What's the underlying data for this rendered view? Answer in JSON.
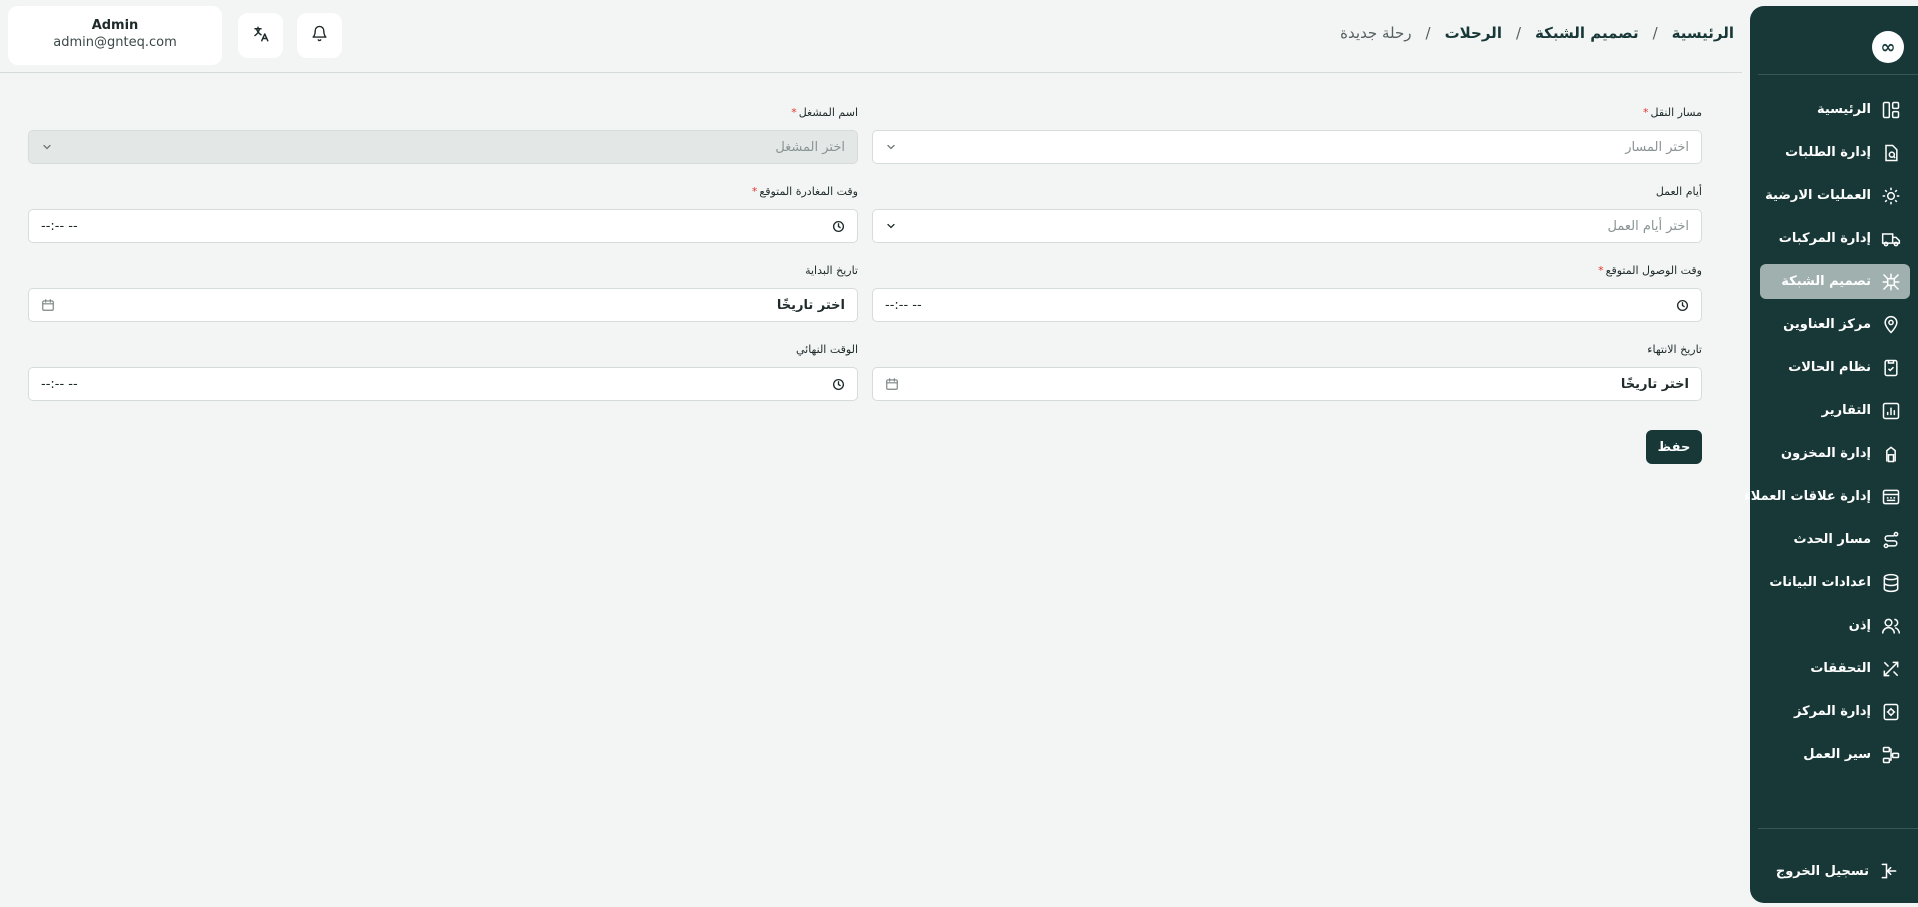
{
  "header": {
    "user": {
      "name": "Admin",
      "email": "admin@gnteq.com"
    },
    "breadcrumb": [
      "الرئيسية",
      "تصميم الشبكة",
      "الرحلات",
      "رحلة جديدة"
    ],
    "separator": "/"
  },
  "sidebar": {
    "logo": "∞",
    "items": [
      {
        "label": "الرئيسية",
        "icon": "dashboard-icon"
      },
      {
        "label": "إدارة الطلبات",
        "icon": "orders-icon"
      },
      {
        "label": "العمليات الارضية",
        "icon": "ground-ops-icon"
      },
      {
        "label": "إدارة المركبات",
        "icon": "truck-icon"
      },
      {
        "label": "تصميم الشبكة",
        "icon": "network-icon",
        "active": true
      },
      {
        "label": "مركز العناوين",
        "icon": "map-pin-icon"
      },
      {
        "label": "نظام الحالات",
        "icon": "status-icon"
      },
      {
        "label": "التقارير",
        "icon": "report-icon"
      },
      {
        "label": "إدارة المخزون",
        "icon": "warehouse-icon"
      },
      {
        "label": "إدارة علاقات العملاء",
        "icon": "crm-icon"
      },
      {
        "label": "مسار الحدث",
        "icon": "route-icon"
      },
      {
        "label": "اعدادات البيانات",
        "icon": "database-icon"
      },
      {
        "label": "إذن",
        "icon": "users-icon"
      },
      {
        "label": "التحققات",
        "icon": "tools-icon"
      },
      {
        "label": "إدارة المركز",
        "icon": "hub-settings-icon"
      },
      {
        "label": "سير العمل",
        "icon": "workflow-icon"
      }
    ],
    "logout": "تسجيل الخروج"
  },
  "form": {
    "route": {
      "label": "مسار النقل",
      "required": true,
      "placeholder": "اختر المسار"
    },
    "operator": {
      "label": "اسم المشغل",
      "required": true,
      "placeholder": "اختر المشغل"
    },
    "work_days": {
      "label": "أيام العمل",
      "placeholder": "اختر أيام العمل"
    },
    "departure_time": {
      "label": "وقت المغادرة المتوقع",
      "required": true,
      "value": "--:-- --"
    },
    "arrival_time": {
      "label": "وقت الوصول المتوقع",
      "required": true,
      "value": "--:-- --"
    },
    "start_date": {
      "label": "تاريخ البداية",
      "value": "اختر تاريخًا"
    },
    "end_date": {
      "label": "تاريخ الانتهاء",
      "value": "اختر تاريخًا"
    },
    "end_time": {
      "label": "الوقت النهائي",
      "value": "--:-- --"
    },
    "save_label": "حفظ"
  },
  "colors": {
    "sidebar_bg": "#183838",
    "active_item_bg": "#9fb0ae",
    "primary_button": "#183838",
    "required_asterisk": "#e0342f",
    "page_bg": "#f3f5f4"
  }
}
